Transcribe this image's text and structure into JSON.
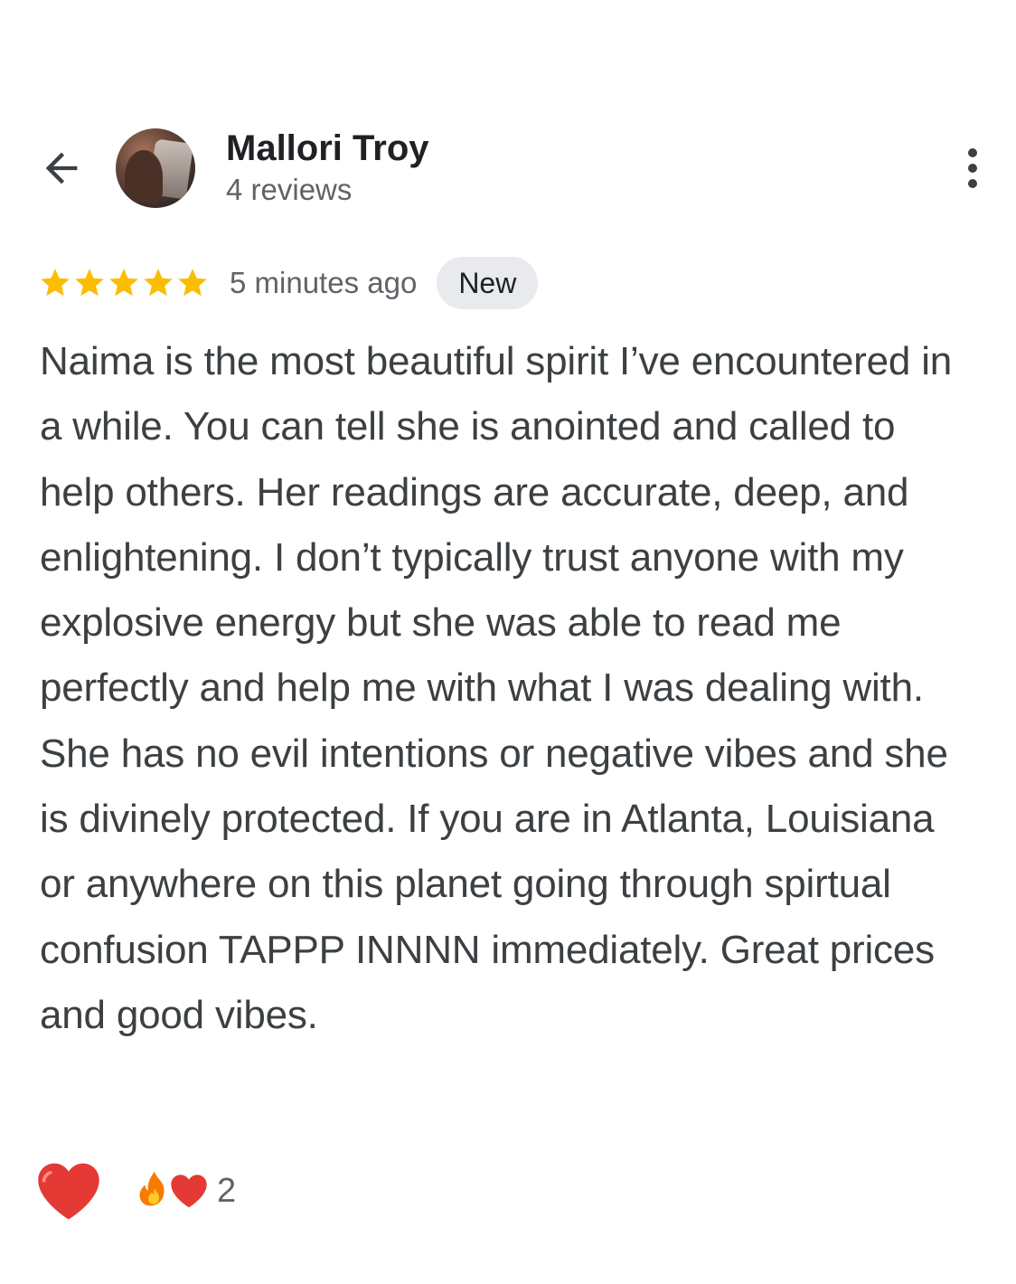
{
  "user": {
    "name": "Mallori Troy",
    "reviews": "4 reviews"
  },
  "review": {
    "rating": 5,
    "time": "5 minutes ago",
    "badge": "New",
    "text": "Naima is the most beautiful spirit I’ve encountered in a while. You can tell she is anointed and called to help others. Her readings are accurate, deep, and enlightening. I don’t typically trust anyone with my explosive energy but she was able to read me perfectly and help me with what I was dealing with. She has no evil intentions or negative vibes and she is divinely protected. If you are in Atlanta, Louisiana or anywhere on this planet going through spirtual confusion TAPPP INNNN immediately. Great prices and good vibes."
  },
  "reactions": {
    "count": "2",
    "icons": [
      "heart-icon",
      "fire-icon",
      "heart-icon"
    ]
  },
  "colors": {
    "star": "#fbbc04",
    "heart": "#e53935",
    "badge_bg": "#e8eaed",
    "text": "#3c4043"
  }
}
